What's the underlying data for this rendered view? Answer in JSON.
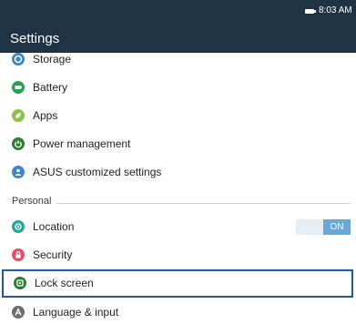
{
  "status_bar": {
    "time": "8:03 AM"
  },
  "header": {
    "title": "Settings"
  },
  "settings": {
    "rows_top": [
      {
        "label": "Storage",
        "icon": "storage-icon",
        "color": "#3d86c9"
      },
      {
        "label": "Battery",
        "icon": "battery-setting-icon",
        "color": "#29a052"
      },
      {
        "label": "Apps",
        "icon": "apps-icon",
        "color": "#8bc34a"
      },
      {
        "label": "Power management",
        "icon": "power-management-icon",
        "color": "#2e7d32"
      },
      {
        "label": "ASUS customized settings",
        "icon": "asus-customized-icon",
        "color": "#3d86c9"
      }
    ],
    "section_personal": "Personal",
    "rows_personal": [
      {
        "label": "Location",
        "icon": "location-icon",
        "color": "#26a69a",
        "toggle": "ON"
      },
      {
        "label": "Security",
        "icon": "security-icon",
        "color": "#e84d64"
      },
      {
        "label": "Lock screen",
        "icon": "lock-screen-icon",
        "color": "#2e7d32"
      },
      {
        "label": "Language & input",
        "icon": "language-input-icon",
        "color": "#6d6d6d"
      }
    ]
  },
  "colors": {
    "header_background": "#1f3344",
    "toggle_on": "#6aa9d6",
    "selection_border": "#1e5b9c"
  }
}
